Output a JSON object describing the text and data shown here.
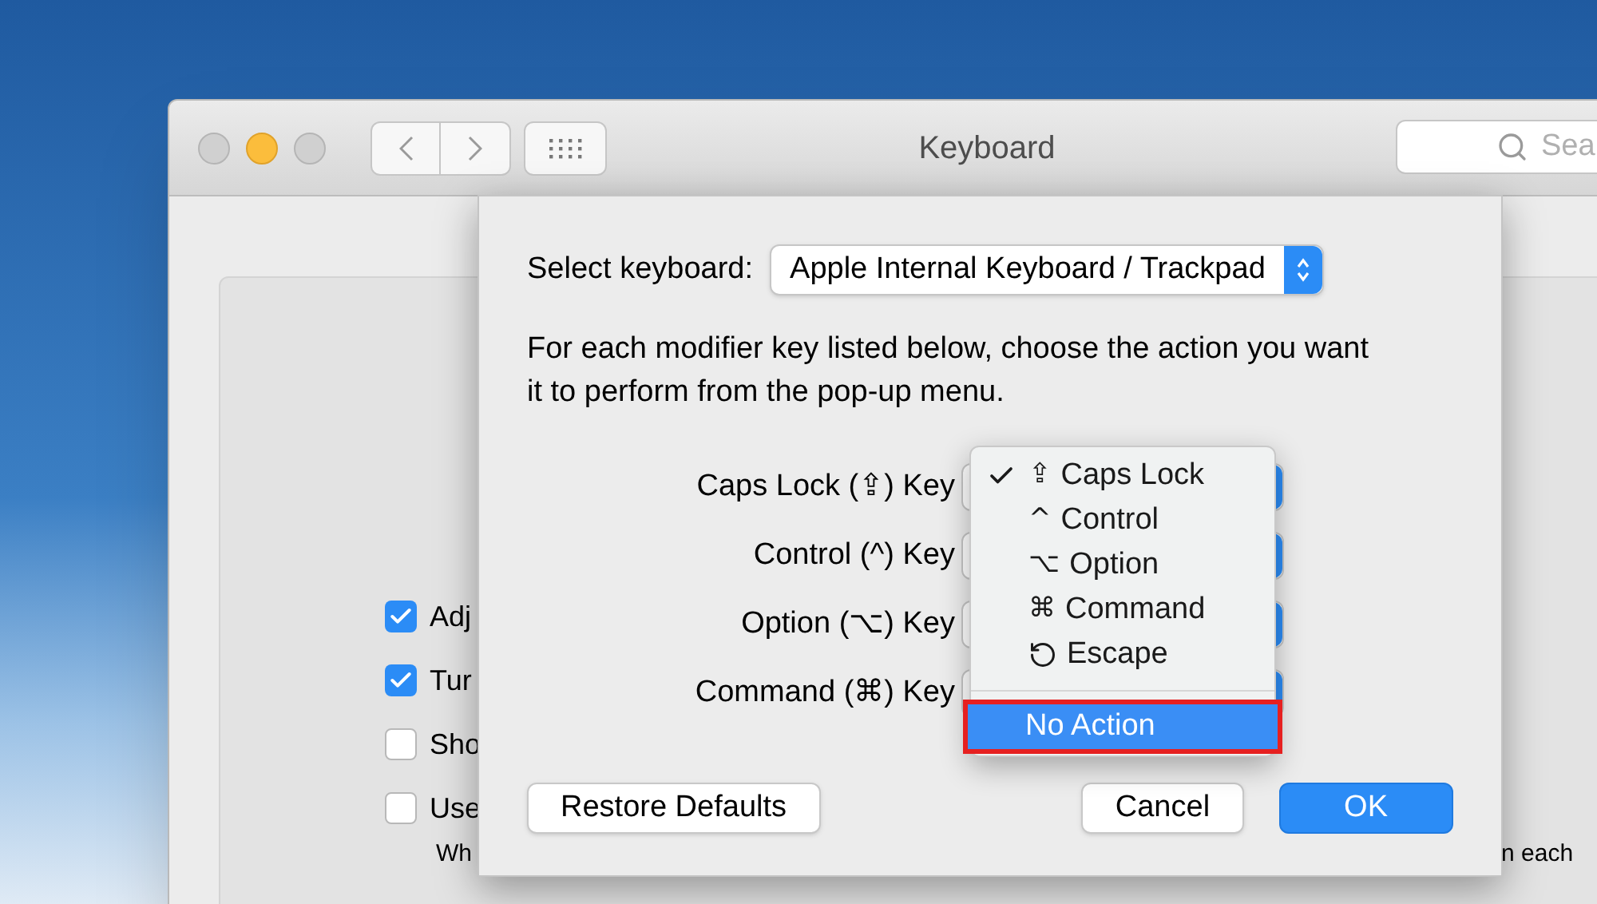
{
  "window": {
    "title": "Keyboard",
    "search_placeholder": "Sea"
  },
  "background_panel": {
    "checkboxes": [
      {
        "label": "Adj",
        "checked": true
      },
      {
        "label": "Tur",
        "checked": true
      },
      {
        "label": "Sho",
        "checked": false
      },
      {
        "label": "Use",
        "checked": false
      }
    ],
    "note_left": "Wh",
    "note_right": "n each"
  },
  "sheet": {
    "select_label": "Select keyboard:",
    "select_value": "Apple Internal Keyboard / Trackpad",
    "instructions": "For each modifier key listed below, choose the action you want it to perform from the pop-up menu.",
    "modifiers": [
      {
        "label": "Caps Lock (⇪) Key"
      },
      {
        "label": "Control (^) Key"
      },
      {
        "label": "Option (⌥) Key"
      },
      {
        "label": "Command (⌘) Key"
      }
    ],
    "menu": [
      {
        "kind": "symbol",
        "symbol": "⇪",
        "label": "Caps Lock",
        "checked": true,
        "highlighted": false
      },
      {
        "kind": "symbol",
        "symbol": "^",
        "label": "Control",
        "checked": false,
        "highlighted": false
      },
      {
        "kind": "symbol",
        "symbol": "⌥",
        "label": "Option",
        "checked": false,
        "highlighted": false
      },
      {
        "kind": "symbol",
        "symbol": "⌘",
        "label": "Command",
        "checked": false,
        "highlighted": false
      },
      {
        "kind": "icon",
        "label": "Escape",
        "checked": false,
        "highlighted": false
      },
      {
        "kind": "separator"
      },
      {
        "kind": "plain",
        "label": "No Action",
        "checked": false,
        "highlighted": true
      }
    ],
    "buttons": [
      {
        "label": "Restore Defaults",
        "default": false
      },
      {
        "label": "Cancel",
        "default": false
      },
      {
        "label": "OK",
        "default": true
      }
    ]
  }
}
